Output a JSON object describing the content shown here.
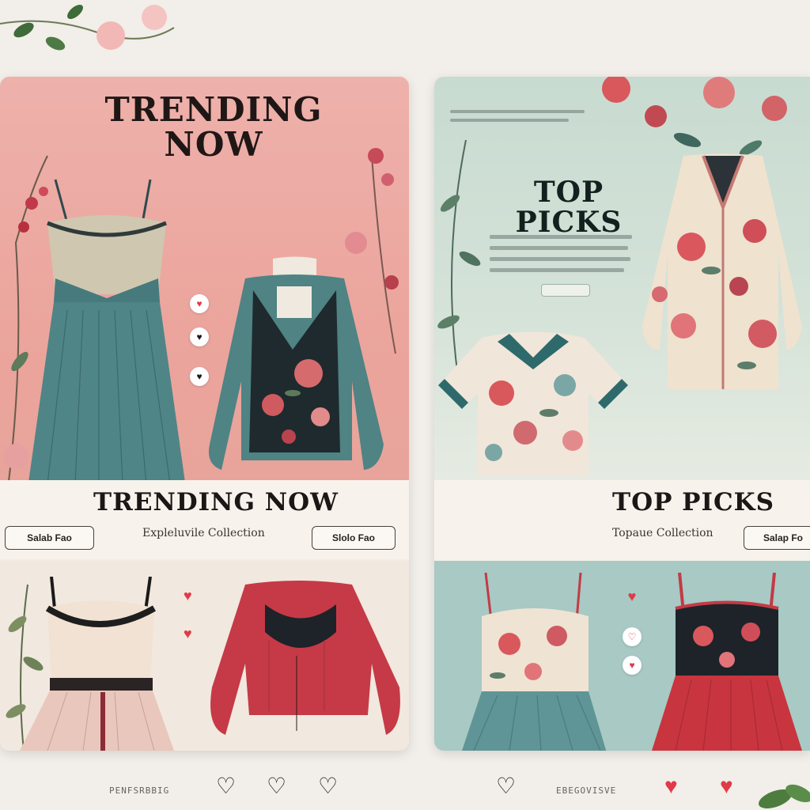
{
  "colors": {
    "page_background": "#f2eee9",
    "left_hero": "#eba59d",
    "right_hero": "#c8dbd0",
    "right_lower": "#a8c9c4",
    "teal_garment": "#4f7c80",
    "red_garment": "#c43a45",
    "heart_red": "#e03a48",
    "heart_outline": "#1a1a1a"
  },
  "panels": {
    "left": {
      "hero_title": "TRENDING NOW",
      "strip_title": "TRENDING NOW",
      "subtitle": "Expleluvile Collection",
      "shop_buttons": [
        "Salab Fao",
        "Slolo Fao"
      ]
    },
    "right": {
      "hero_title": "TOP PICKS",
      "strip_title": "TOP PICKS",
      "subtitle": "Topaue Collection",
      "shop_button": "Salap Fo"
    }
  },
  "heart_icons": {
    "left_hero": [
      "heart-icon",
      "heart-icon",
      "heart-icon",
      "heart-icon"
    ],
    "left_lower": [
      "heart-icon",
      "heart-icon"
    ],
    "right_lower": [
      "heart-icon",
      "heart-outline-icon",
      "heart-icon"
    ]
  },
  "footer": {
    "left_label": "PENFSRBBIG",
    "right_label": "EBEGOVISVE",
    "hearts_left": [
      "heart-outline-icon",
      "heart-outline-icon",
      "heart-outline-icon"
    ],
    "hearts_right": [
      "heart-outline-icon",
      "heart-filled-icon",
      "heart-filled-icon"
    ]
  }
}
